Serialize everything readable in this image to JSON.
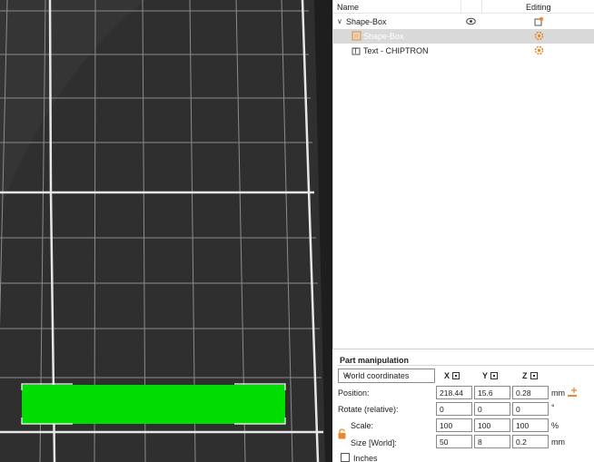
{
  "object_list": {
    "header": {
      "name": "Name",
      "editing": "Editing"
    },
    "rows": [
      {
        "label": "Shape-Box",
        "icon": "chevron-down-icon",
        "eye_icon": "eye-icon",
        "edit_icon": "edit-settings-icon"
      },
      {
        "label": "Shape-Box",
        "icon": "shape-part-icon",
        "edit_icon": "gear-icon",
        "selected": true
      },
      {
        "label": "Text - CHIPTRON",
        "icon": "text-part-icon",
        "edit_icon": "gear-icon"
      }
    ]
  },
  "part_manipulation": {
    "title": "Part manipulation",
    "coordinate_system": "World coordinates",
    "axes": [
      "X",
      "Y",
      "Z"
    ],
    "rows": [
      {
        "label": "Position:",
        "values": [
          "218.44",
          "15.6",
          "0.28"
        ],
        "unit": "mm"
      },
      {
        "label": "Rotate (relative):",
        "values": [
          "0",
          "0",
          "0"
        ],
        "unit": "°"
      },
      {
        "label": "Scale:",
        "values": [
          "100",
          "100",
          "100"
        ],
        "unit": "%"
      },
      {
        "label": "Size [World]:",
        "values": [
          "50",
          "8",
          "0.2"
        ],
        "unit": "mm"
      }
    ],
    "inches_label": "Inches"
  },
  "colors": {
    "viewport_bg": "#2f2f2f",
    "grid": "#8c8c8c",
    "grid_major": "#e0e0e0",
    "object_green": "#00dd00",
    "accent_orange": "#e8892b",
    "selection_bg": "#d9d9d9"
  }
}
